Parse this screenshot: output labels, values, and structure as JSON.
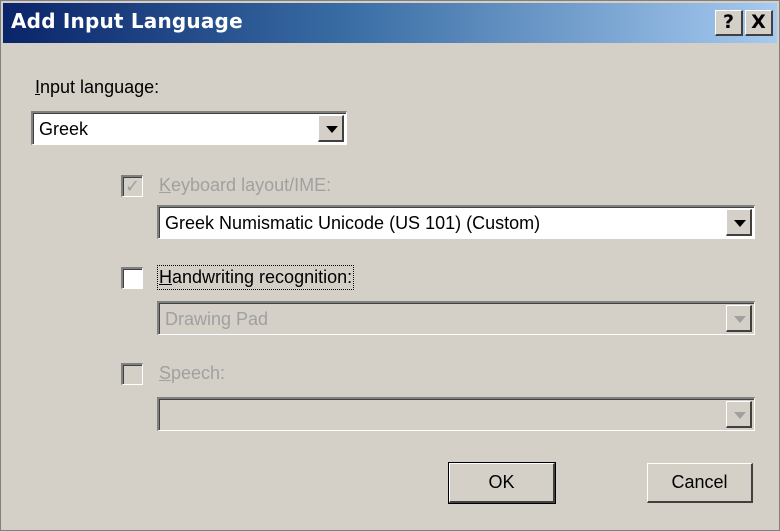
{
  "window": {
    "title": "Add Input Language",
    "help_label": "?",
    "close_label": "X"
  },
  "input_language": {
    "label_underlined": "I",
    "label_rest": "nput language:",
    "selected": "Greek"
  },
  "keyboard": {
    "checked_glyph": "✓",
    "label_underlined": "K",
    "label_rest": "eyboard layout/IME:",
    "selected": "Greek Numismatic Unicode (US 101) (Custom)"
  },
  "handwriting": {
    "label_underlined": "H",
    "label_rest": "andwriting recognition:",
    "selected": "Drawing Pad"
  },
  "speech": {
    "label_underlined": "S",
    "label_rest": "peech:",
    "selected": ""
  },
  "buttons": {
    "ok": "OK",
    "cancel": "Cancel"
  }
}
